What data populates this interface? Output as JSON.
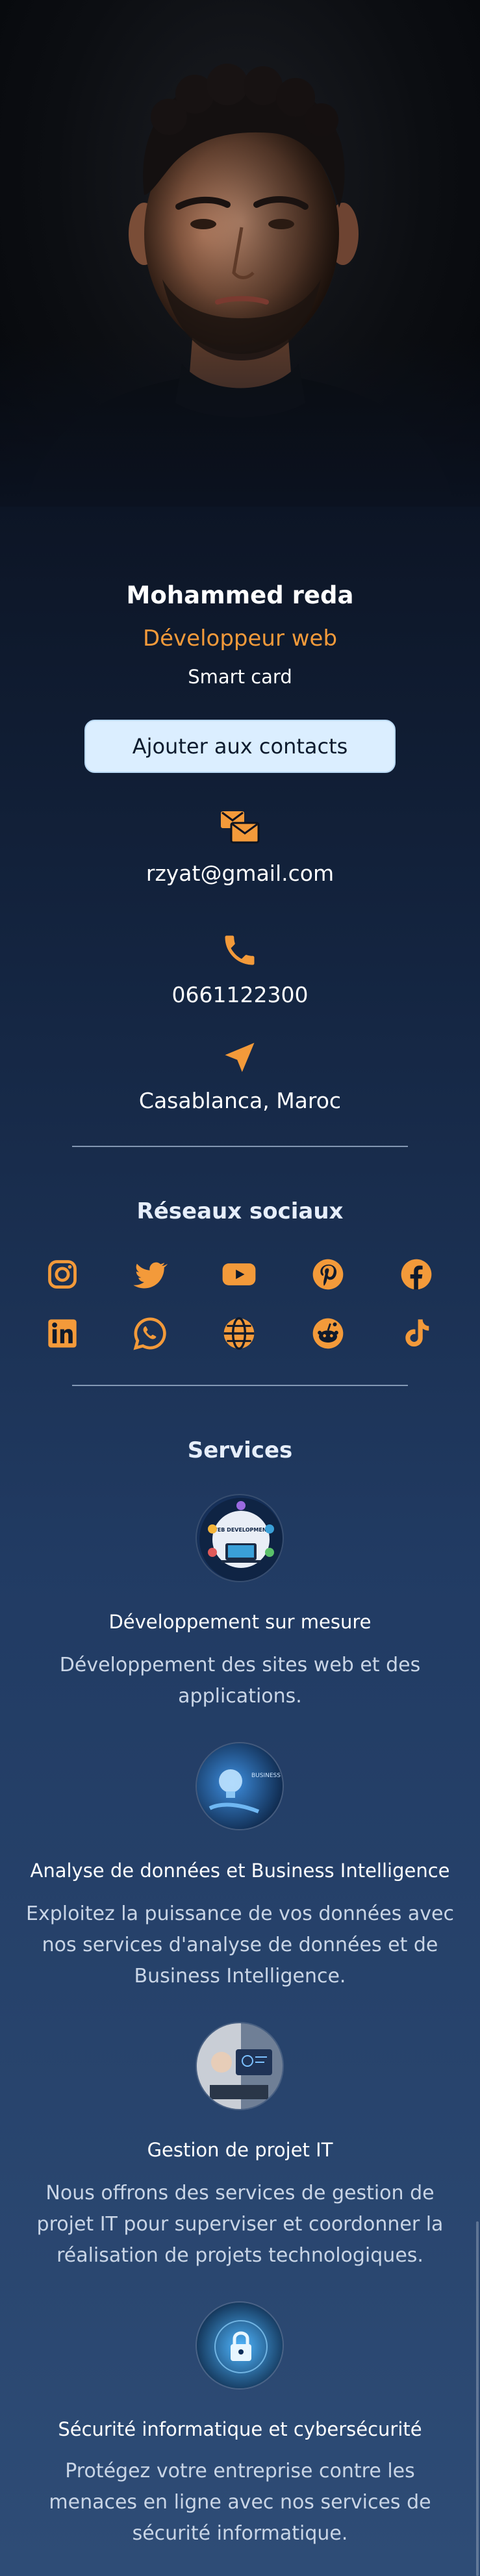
{
  "profile": {
    "name": "Mohammed reda",
    "role": "Développeur web",
    "tagline": "Smart card",
    "add_contact_label": "Ajouter aux contacts"
  },
  "contact": {
    "email": "rzyat@gmail.com",
    "phone": "0661122300",
    "location": "Casablanca, Maroc"
  },
  "social": {
    "title": "Réseaux sociaux",
    "icons": [
      "instagram-icon",
      "twitter-icon",
      "youtube-icon",
      "pinterest-icon",
      "facebook-icon",
      "linkedin-icon",
      "whatsapp-icon",
      "globe-icon",
      "reddit-icon",
      "tiktok-icon"
    ]
  },
  "services": {
    "title": "Services",
    "items": [
      {
        "title": "Développement sur mesure",
        "description": "Développement des sites web et des applications.",
        "image_text": "WEB DEVELOPMENT"
      },
      {
        "title": "Analyse de données et Business Intelligence",
        "description": "Exploitez la puissance de vos données avec nos services d'analyse de données et de Business Intelligence.",
        "image_text": "BUSINESS INTELLIG"
      },
      {
        "title": "Gestion de projet IT",
        "description": "Nous offrons des services de gestion de projet IT pour superviser et coordonner la réalisation de projets technologiques."
      },
      {
        "title": "Sécurité informatique et cybersécurité",
        "description": "Protégez votre entreprise contre les menaces en ligne avec nos services de sécurité informatique."
      }
    ]
  },
  "colors": {
    "accent": "#f39a3a",
    "button_bg": "#dbeeff",
    "background_top": "#060a12",
    "background_bottom": "#2e4c76"
  }
}
